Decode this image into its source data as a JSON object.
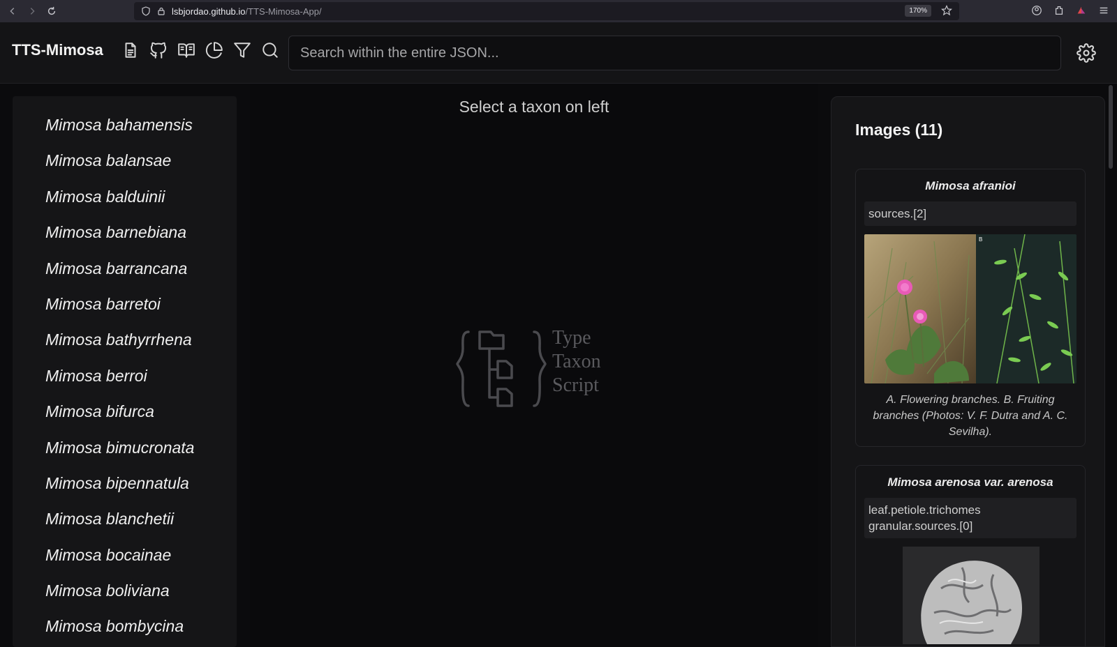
{
  "browser": {
    "url_host": "lsbjordao.github.io",
    "url_path": "/TTS-Mimosa-App/",
    "zoom": "170%"
  },
  "header": {
    "title": "TTS-Mimosa",
    "search_placeholder": "Search within the entire JSON...",
    "icons": [
      "document-icon",
      "github-icon",
      "book-icon",
      "pie-chart-icon",
      "filter-icon",
      "search-icon",
      "gear-icon"
    ]
  },
  "taxa": [
    "Mimosa bahamensis",
    "Mimosa balansae",
    "Mimosa balduinii",
    "Mimosa barnebiana",
    "Mimosa barrancana",
    "Mimosa barretoi",
    "Mimosa bathyrrhena",
    "Mimosa berroi",
    "Mimosa bifurca",
    "Mimosa bimucronata",
    "Mimosa bipennatula",
    "Mimosa blanchetii",
    "Mimosa bocainae",
    "Mimosa boliviana",
    "Mimosa bombycina"
  ],
  "center": {
    "message": "Select a taxon on left",
    "logo_lines": [
      "Type",
      "Taxon",
      "Script"
    ]
  },
  "images": {
    "title": "Images (11)",
    "cards": [
      {
        "taxon": "Mimosa afranioi",
        "path": "sources.[2]",
        "caption": "A. Flowering branches. B. Fruiting branches (Photos: V. F. Dutra and A. C. Sevilha)."
      },
      {
        "taxon": "Mimosa arenosa var. arenosa",
        "path": "leaf.petiole.trichomes granular.sources.[0]",
        "caption": ""
      }
    ]
  },
  "colors": {
    "background": "#0b0b0d",
    "panel": "#151517",
    "accent_flower": "#e85ab6"
  }
}
